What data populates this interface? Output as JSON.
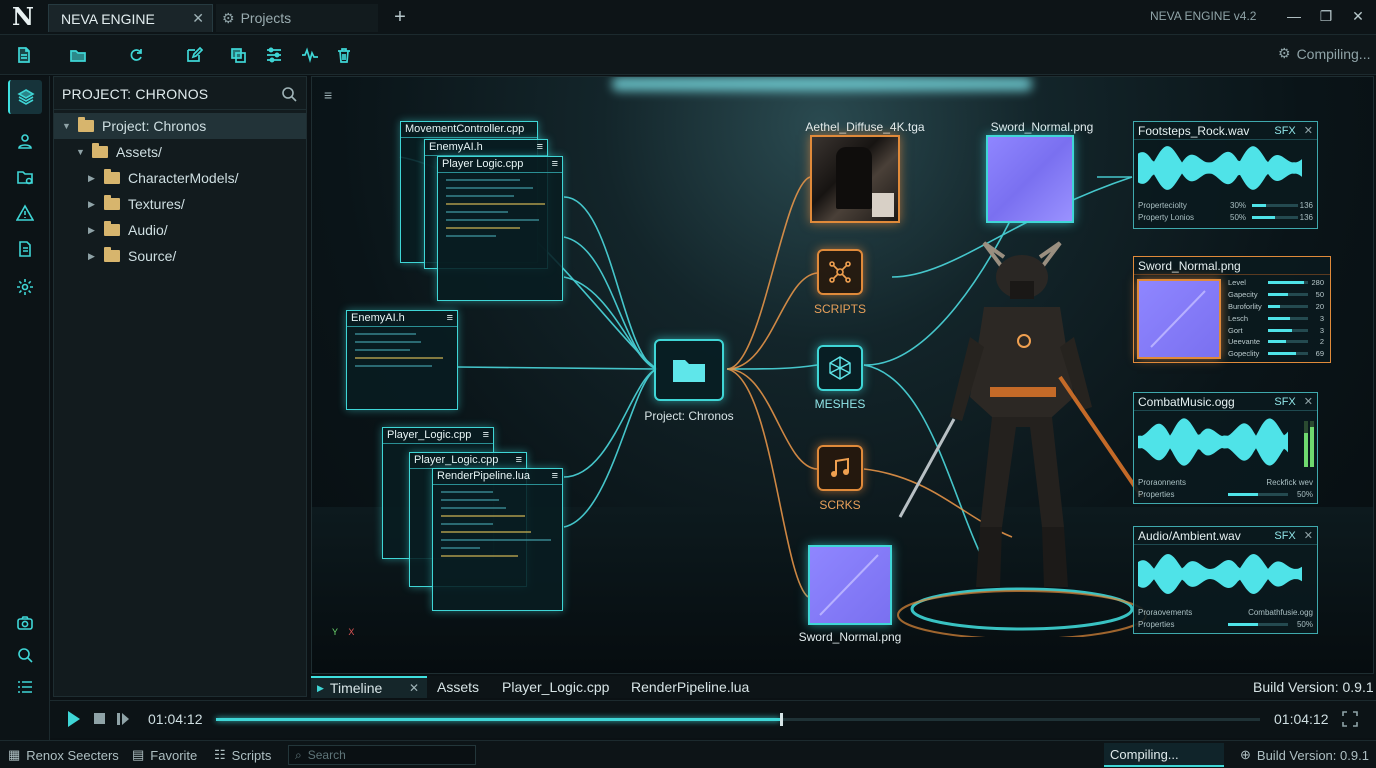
{
  "titlebar": {
    "logo": "N",
    "tabs": [
      {
        "label": "NEVA ENGINE",
        "active": true
      },
      {
        "label": "Projects",
        "active": false
      }
    ],
    "version": "NEVA ENGINE v4.2"
  },
  "toolbar": {
    "icons": [
      "new-file-icon",
      "open-folder-icon",
      "refresh-icon",
      "edit-icon",
      "copy-icon",
      "sliders-icon",
      "waveform-icon",
      "trash-icon"
    ],
    "status": "Compiling..."
  },
  "rail": {
    "top_icons": [
      "layers-icon",
      "user-icon",
      "folder-add-icon",
      "warning-icon",
      "document-icon",
      "settings-icon"
    ],
    "bottom_icons": [
      "camera-icon",
      "search-icon",
      "list-icon",
      "settings-icon"
    ]
  },
  "project": {
    "title": "PROJECT: CHRONOS",
    "tree": [
      {
        "label": "Project: Chronos",
        "depth": 0,
        "expanded": true
      },
      {
        "label": "Assets/",
        "depth": 1,
        "expanded": true
      },
      {
        "label": "CharacterModels/",
        "depth": 2,
        "expanded": false
      },
      {
        "label": "Textures/",
        "depth": 2,
        "expanded": false
      },
      {
        "label": "Audio/",
        "depth": 2,
        "expanded": false
      },
      {
        "label": "Source/",
        "depth": 2,
        "expanded": false
      }
    ]
  },
  "viewport": {
    "code_cards": [
      {
        "title": "MovementController.cpp"
      },
      {
        "title": "EnemyAI.h"
      },
      {
        "title": "Player Logic.cpp"
      },
      {
        "title": "EnemyAI.h"
      },
      {
        "title": "Player_Logic.cpp"
      },
      {
        "title": "Player_Logic.cpp"
      },
      {
        "title": "RenderPipeline.lua"
      }
    ],
    "hub_label": "Project: Chronos",
    "nodes": [
      {
        "label": "SCRIPTS"
      },
      {
        "label": "MESHES"
      },
      {
        "label": "SCRKS"
      }
    ],
    "textures": [
      {
        "label": "Aethel_Diffuse_4K.tga"
      },
      {
        "label": "Sword_Normal.png"
      },
      {
        "label": "Sword_Normal.png"
      }
    ],
    "audio_panels": [
      {
        "title": "Footsteps_Rock.wav",
        "tag": "SFX",
        "rows": [
          {
            "name": "Properteciolty",
            "pct": "30%",
            "val": "136",
            "level": 0.3
          },
          {
            "name": "Property Lonios",
            "pct": "50%",
            "val": "136",
            "level": 0.5
          }
        ]
      },
      {
        "title": "CombatMusic.ogg",
        "tag": "SFX",
        "left": "Proraonnents",
        "right": "Reckfick wev",
        "prop": "Properties",
        "pct": "50%",
        "level": 0.5
      },
      {
        "title": "Audio/Ambient.wav",
        "tag": "SFX",
        "left": "Proraovements",
        "right": "Combathfusie.ogg",
        "prop": "Properties",
        "pct": "50%",
        "level": 0.5
      }
    ],
    "texture_panel": {
      "title": "Sword_Normal.png",
      "stats": [
        {
          "name": "Level",
          "value": "280",
          "level": 0.9
        },
        {
          "name": "Gapecity",
          "value": "50",
          "level": 0.5
        },
        {
          "name": "Buroforlity",
          "value": "20",
          "level": 0.3
        },
        {
          "name": "Lesch",
          "value": "3",
          "level": 0.55
        },
        {
          "name": "Gort",
          "value": "3",
          "level": 0.6
        },
        {
          "name": "Ueevante",
          "value": "2",
          "level": 0.45
        },
        {
          "name": "Gopeclity",
          "value": "69",
          "level": 0.7
        }
      ]
    },
    "axis": {
      "x": "X",
      "y": "Y"
    }
  },
  "bottom_tabs": [
    "Timeline",
    "Assets",
    "Player_Logic.cpp",
    "RenderPipeline.lua"
  ],
  "build_version": "Build Version: 0.9.1",
  "transport": {
    "time_current": "01:04:12",
    "time_end": "01:04:12",
    "progress": 0.54
  },
  "status": {
    "items": [
      "Renox Seecters",
      "Favorite",
      "Scripts"
    ],
    "search_placeholder": "Search",
    "compiling": "Compiling...",
    "build_version": "Build Version: 0.9.1"
  },
  "colors": {
    "accent": "#3fd6d6",
    "orange": "#e08a3a",
    "background": "#0b1114"
  }
}
